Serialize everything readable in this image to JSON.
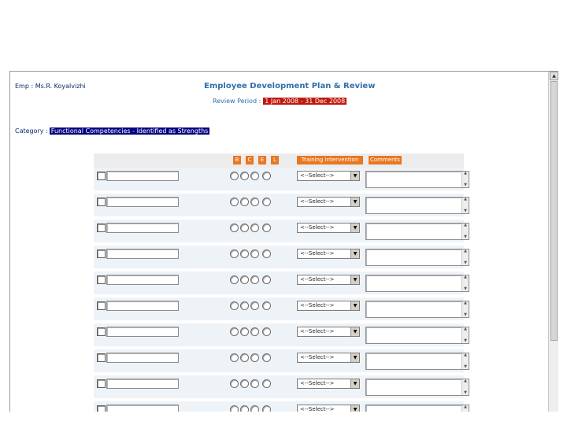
{
  "header": {
    "emp": "Emp : Ms.R. Koyalvizhi",
    "title": "Employee Development Plan & Review",
    "review_label": "Review Period :",
    "review_value": "1 Jan 2008 - 31 Dec 2008",
    "category_label": "Category :",
    "category_value": "Functional Competencies - Identified as Strengths"
  },
  "table": {
    "headers": [
      "B",
      "C",
      "E",
      "L",
      "Training Intervention",
      "Comments"
    ],
    "select_placeholder": "<--Select-->",
    "row_count": 10
  },
  "colors": {
    "accent": "#e87722",
    "title_blue": "#2f6fa8",
    "review_bg": "#c0170f",
    "category_bg": "#000080"
  }
}
